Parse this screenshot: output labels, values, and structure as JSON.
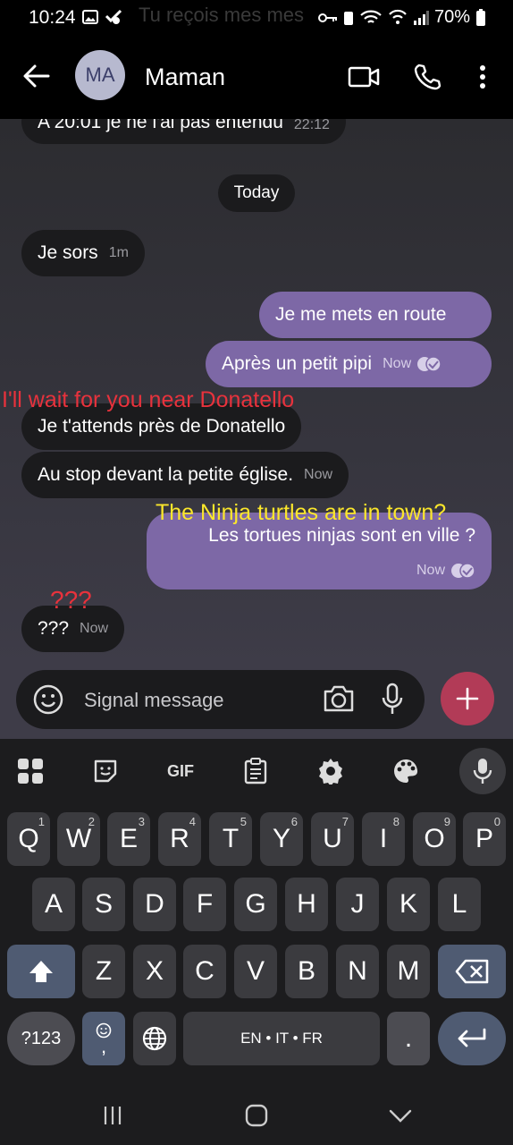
{
  "status_bar": {
    "time": "10:24",
    "battery": "70%",
    "notification_ghost": "Tu reçois mes mes"
  },
  "header": {
    "avatar_initials": "MA",
    "contact_name": "Maman"
  },
  "conversation": {
    "date_separator": "Today",
    "messages": [
      {
        "direction": "in",
        "text": "A 20:01 je ne l'ai pas entendu",
        "time": "22:12"
      },
      {
        "direction": "in",
        "text": "Je sors",
        "time": "1m"
      },
      {
        "direction": "out",
        "text": "Je me mets en route",
        "time": ""
      },
      {
        "direction": "out",
        "text": "Après un petit pipi",
        "time": "Now",
        "status": "read"
      },
      {
        "direction": "in",
        "text": "Je t'attends près de Donatello",
        "time": ""
      },
      {
        "direction": "in",
        "text": "Au stop devant la petite église.",
        "time": "Now"
      },
      {
        "direction": "out",
        "text": "Les tortues ninjas sont en ville ?",
        "time": "Now",
        "status": "read"
      },
      {
        "direction": "in",
        "text": "???",
        "time": "Now"
      }
    ],
    "overlays": [
      {
        "text": "I'll wait for you near Donatello",
        "color": "#e8323c"
      },
      {
        "text": "The Ninja turtles are in town?",
        "color": "#fbe72b"
      },
      {
        "text": "???",
        "color": "#e8323c"
      }
    ]
  },
  "composer": {
    "placeholder": "Signal message"
  },
  "keyboard": {
    "toolbar": [
      "apps-icon",
      "sticker-icon",
      "GIF",
      "clipboard-icon",
      "gear-icon",
      "palette-icon",
      "mic-icon"
    ],
    "row1": [
      {
        "k": "Q",
        "n": "1"
      },
      {
        "k": "W",
        "n": "2"
      },
      {
        "k": "E",
        "n": "3"
      },
      {
        "k": "R",
        "n": "4"
      },
      {
        "k": "T",
        "n": "5"
      },
      {
        "k": "Y",
        "n": "6"
      },
      {
        "k": "U",
        "n": "7"
      },
      {
        "k": "I",
        "n": "8"
      },
      {
        "k": "O",
        "n": "9"
      },
      {
        "k": "P",
        "n": "0"
      }
    ],
    "row2": [
      "A",
      "S",
      "D",
      "F",
      "G",
      "H",
      "J",
      "K",
      "L"
    ],
    "row3": [
      "Z",
      "X",
      "C",
      "V",
      "B",
      "N",
      "M"
    ],
    "symbols_key": "?123",
    "emoji_comma": ",",
    "space_label": "EN • IT • FR",
    "period": "."
  },
  "colors": {
    "outgoing_bubble": "#7d68a6",
    "incoming_bubble": "#1b1b1d",
    "accent_plus": "#b23b57"
  }
}
